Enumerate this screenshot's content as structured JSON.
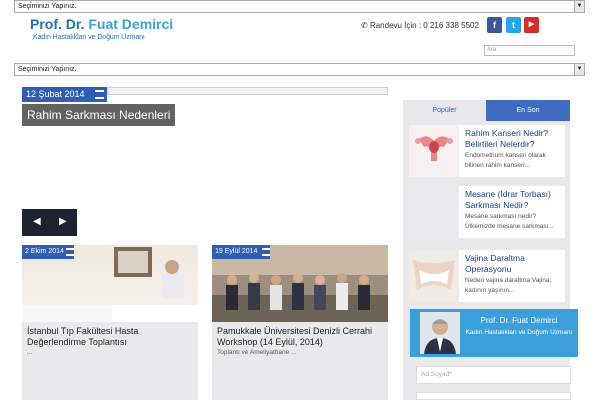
{
  "header": {
    "select_top": "Seçiminizi Yapınız.",
    "logo_title_a": "Prof. Dr. ",
    "logo_title_b": "Fuat Demirci",
    "logo_subtitle": "Kadın Hastalıkları ve Doğum Uzmanı",
    "phone_text": "Randevu İçin : 0 216 338 5502",
    "social": [
      {
        "name": "facebook",
        "glyph": "f",
        "color": "#3b5998"
      },
      {
        "name": "twitter",
        "glyph": "t",
        "color": "#2aa3ef"
      },
      {
        "name": "youtube",
        "glyph": "▶",
        "color": "#d62d2d"
      }
    ],
    "search_placeholder": "Ara",
    "select_mid": "Seçiminizi Yapınız."
  },
  "slider": {
    "date": "12 Şubat 2014",
    "headline": "Rahim Sarkması Nedenleri"
  },
  "cards": [
    {
      "date": "2 Ekim 2014",
      "title": "İstanbul Tıp Fakültesi Hasta Değerlendirme Toplantısı",
      "excerpt": "..."
    },
    {
      "date": "19 Eylül 2014",
      "title": "Pamukkale Üniversitesi Denizli Cerrahi Workshop (14 Eylül, 2014)",
      "excerpt": "Toplantı ve Ameliyathane ..."
    }
  ],
  "sidebar": {
    "tabs": [
      "Popüler",
      "En Son"
    ],
    "items": [
      {
        "title": "Rahim Kanseri Nedir? Belirtileri Nelerdir?",
        "excerpt": "Endometrium kanseri olarak bilinen rahim kanseri..."
      },
      {
        "title": "Mesane (İdrar Torbası) Sarkması Nedir?",
        "excerpt": "Mesane sarkması nedir? Ülkemizde mesane sarkması..."
      },
      {
        "title": "Vajina Daraltma Operasyonu",
        "excerpt": "Neden vajina daraltma Vajina; kadının yaşının..."
      }
    ],
    "profile_name": "Prof. Dr. Fuat Demirci",
    "profile_sub": "Kadın Hastalıkları ve Doğum Uzmanı",
    "field_name_placeholder": "Ad Soyad*"
  }
}
